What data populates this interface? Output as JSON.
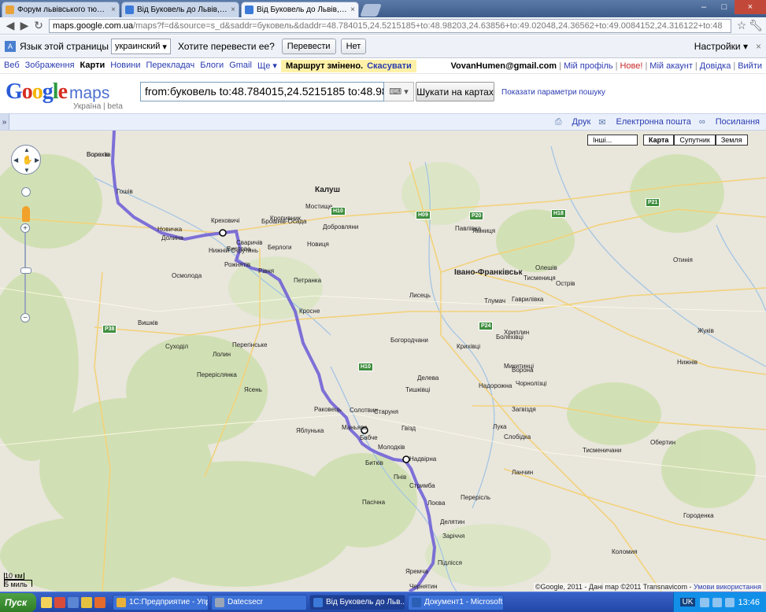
{
  "browser": {
    "tabs": [
      {
        "title": "Форум львівського тюнін...",
        "close": "×",
        "active": false,
        "favicon_color": "#e8a43a"
      },
      {
        "title": "Від Буковель до Львів, Л...",
        "close": "×",
        "active": false,
        "favicon_color": "#3b7ad8"
      },
      {
        "title": "Від Буковель до Львів, Л...",
        "close": "×",
        "active": true,
        "favicon_color": "#3b7ad8"
      }
    ],
    "window_controls": {
      "min": "–",
      "max": "□",
      "close": "×"
    },
    "address": {
      "host": "maps.google.com.ua",
      "path": "/maps?f=d&source=s_d&saddr=буковель&daddr=48.784015,24.5215185+to:48.98203,24.63856+to:49.02048,24.36562+to:49.0084152,24.316122+to:48"
    }
  },
  "translate_bar": {
    "label": "Язык этой страницы",
    "language": "украинский",
    "question": "Хотите перевести ее?",
    "translate_btn": "Перевести",
    "no_btn": "Нет",
    "settings": "Настройки ▾",
    "close": "×"
  },
  "gbar": {
    "links": [
      {
        "label": "Веб",
        "current": false
      },
      {
        "label": "Зображення",
        "current": false
      },
      {
        "label": "Карти",
        "current": true
      },
      {
        "label": "Новини",
        "current": false
      },
      {
        "label": "Перекладач",
        "current": false
      },
      {
        "label": "Блоги",
        "current": false
      },
      {
        "label": "Gmail",
        "current": false
      },
      {
        "label": "Ще ▾",
        "current": false
      }
    ],
    "notice": "Маршрут змінено.",
    "notice_undo": "Скасувати",
    "user_email": "VovanHumen@gmail.com",
    "right_links": [
      "Мій профіль",
      "Нове!",
      "Мій акаунт",
      "Довідка",
      "Вийти"
    ]
  },
  "header": {
    "logo_google": "Google",
    "logo_maps": "maps",
    "logo_sub": "Україна | beta",
    "search_value": "from:буковель to:48.784015,24.5215185 to:48.98",
    "search_button": "Шукати на картах",
    "search_options": "Показати параметри пошуку"
  },
  "actions": {
    "collapse": "»",
    "print": "Друк",
    "email": "Електронна пошта",
    "link": "Посилання"
  },
  "map": {
    "controls": {
      "more": "Інші...",
      "map": "Карта",
      "satellite": "Супутник",
      "earth": "Земля"
    },
    "cities": [
      {
        "name": "Калуш"
      },
      {
        "name": "Івано-Франківськ"
      }
    ],
    "towns": [
      "Болехів",
      "Гошів",
      "Новичка",
      "Долина",
      "Креховичі",
      "Нижній Струтинь",
      "Сваричів",
      "Рожнятів",
      "Рівня",
      "Петранка",
      "Брошнів-Осада",
      "Перегінське",
      "Кросне",
      "Вистова",
      "Новиця",
      "Берлоги",
      "Добровляни",
      "Мостище",
      "Кропивник",
      "Павлівка",
      "Ямниця",
      "Тисмениця",
      "Тлумач",
      "Болехівці",
      "Лисець",
      "Богородчани",
      "Солотвин",
      "Старуня",
      "Бабче",
      "Надвірна",
      "Делятин",
      "Заріччя",
      "Яремча",
      "Пасічна",
      "Битків",
      "Пнів",
      "Стримба",
      "Ланчин",
      "Перерісль",
      "Коломия",
      "Городенка",
      "Обертин",
      "Тисменичани",
      "Гвізд",
      "Підлісся",
      "Лоєва",
      "Молодків",
      "Маньява",
      "Раковець",
      "Яблунька",
      "Осмолода",
      "Вишків",
      "Суходіл",
      "Лолин",
      "Ясень",
      "Переріслянка",
      "Хриплин",
      "Микитинці",
      "Крихівці",
      "Надорожна",
      "Лука",
      "Слобідка",
      "Гаврилівка",
      "Острів",
      "Чорнолізці",
      "Загвіздя",
      "Ворона",
      "Олешів",
      "Отинія",
      "Нижнів",
      "Жуків",
      "Делева",
      "Тишківці",
      "Чернятин",
      "Ворохта"
    ],
    "shields": [
      "H10",
      "H09",
      "P20",
      "H18",
      "P21",
      "P38",
      "H10",
      "P24"
    ],
    "scale": {
      "metric": "10 км",
      "imperial": "5 миль"
    },
    "copyright": "©Google, 2011 - Дані map ©2011 Transnavicom -",
    "terms": "Умови використання"
  },
  "taskbar": {
    "start": "Пуск",
    "tasks": [
      {
        "label": "1С:Предприятие - Упра...",
        "active": false,
        "icon_color": "#e8b23a"
      },
      {
        "label": "Datecsecr",
        "active": false,
        "icon_color": "#9aa6b8"
      },
      {
        "label": "Від Буковель до Льв...",
        "active": true,
        "icon_color": "#3b7ad8"
      },
      {
        "label": "Документ1 - Microsoft ...",
        "active": false,
        "icon_color": "#2b5eb5"
      }
    ],
    "lang": "UK",
    "time": "13:46"
  }
}
